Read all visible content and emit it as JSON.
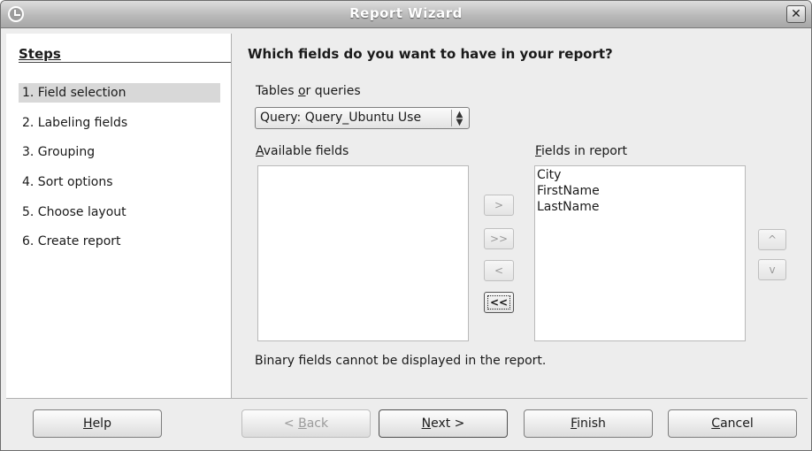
{
  "window": {
    "title": "Report Wizard",
    "close_glyph": "✕"
  },
  "steps": {
    "heading": "Steps",
    "items": [
      {
        "label": "1. Field selection",
        "active": true
      },
      {
        "label": "2. Labeling fields",
        "active": false
      },
      {
        "label": "3. Grouping",
        "active": false
      },
      {
        "label": "4. Sort options",
        "active": false
      },
      {
        "label": "5. Choose layout",
        "active": false
      },
      {
        "label": "6. Create report",
        "active": false
      }
    ]
  },
  "main": {
    "question": "Which fields do you want to have in your report?",
    "tables_label_pre": "Tables ",
    "tables_label_key": "o",
    "tables_label_post": "r queries",
    "tables_value": "Query: Query_Ubuntu Use",
    "available_label_key": "A",
    "available_label_rest": "vailable fields",
    "available_fields": [],
    "report_label_key": "F",
    "report_label_rest": "ields in report",
    "report_fields": [
      "City",
      "FirstName",
      "LastName"
    ],
    "move_buttons": {
      "add": ">",
      "add_all": ">>",
      "remove": "<",
      "remove_all": "<<"
    },
    "order_buttons": {
      "up": "^",
      "down": "v"
    },
    "info": "Binary fields cannot be displayed in the report."
  },
  "footer": {
    "help_key": "H",
    "help_rest": "elp",
    "back_pre": "< ",
    "back_key": "B",
    "back_rest": "ack",
    "next_key": "N",
    "next_rest": "ext >",
    "finish_key": "F",
    "finish_rest": "inish",
    "cancel_key": "C",
    "cancel_rest": "ancel"
  }
}
